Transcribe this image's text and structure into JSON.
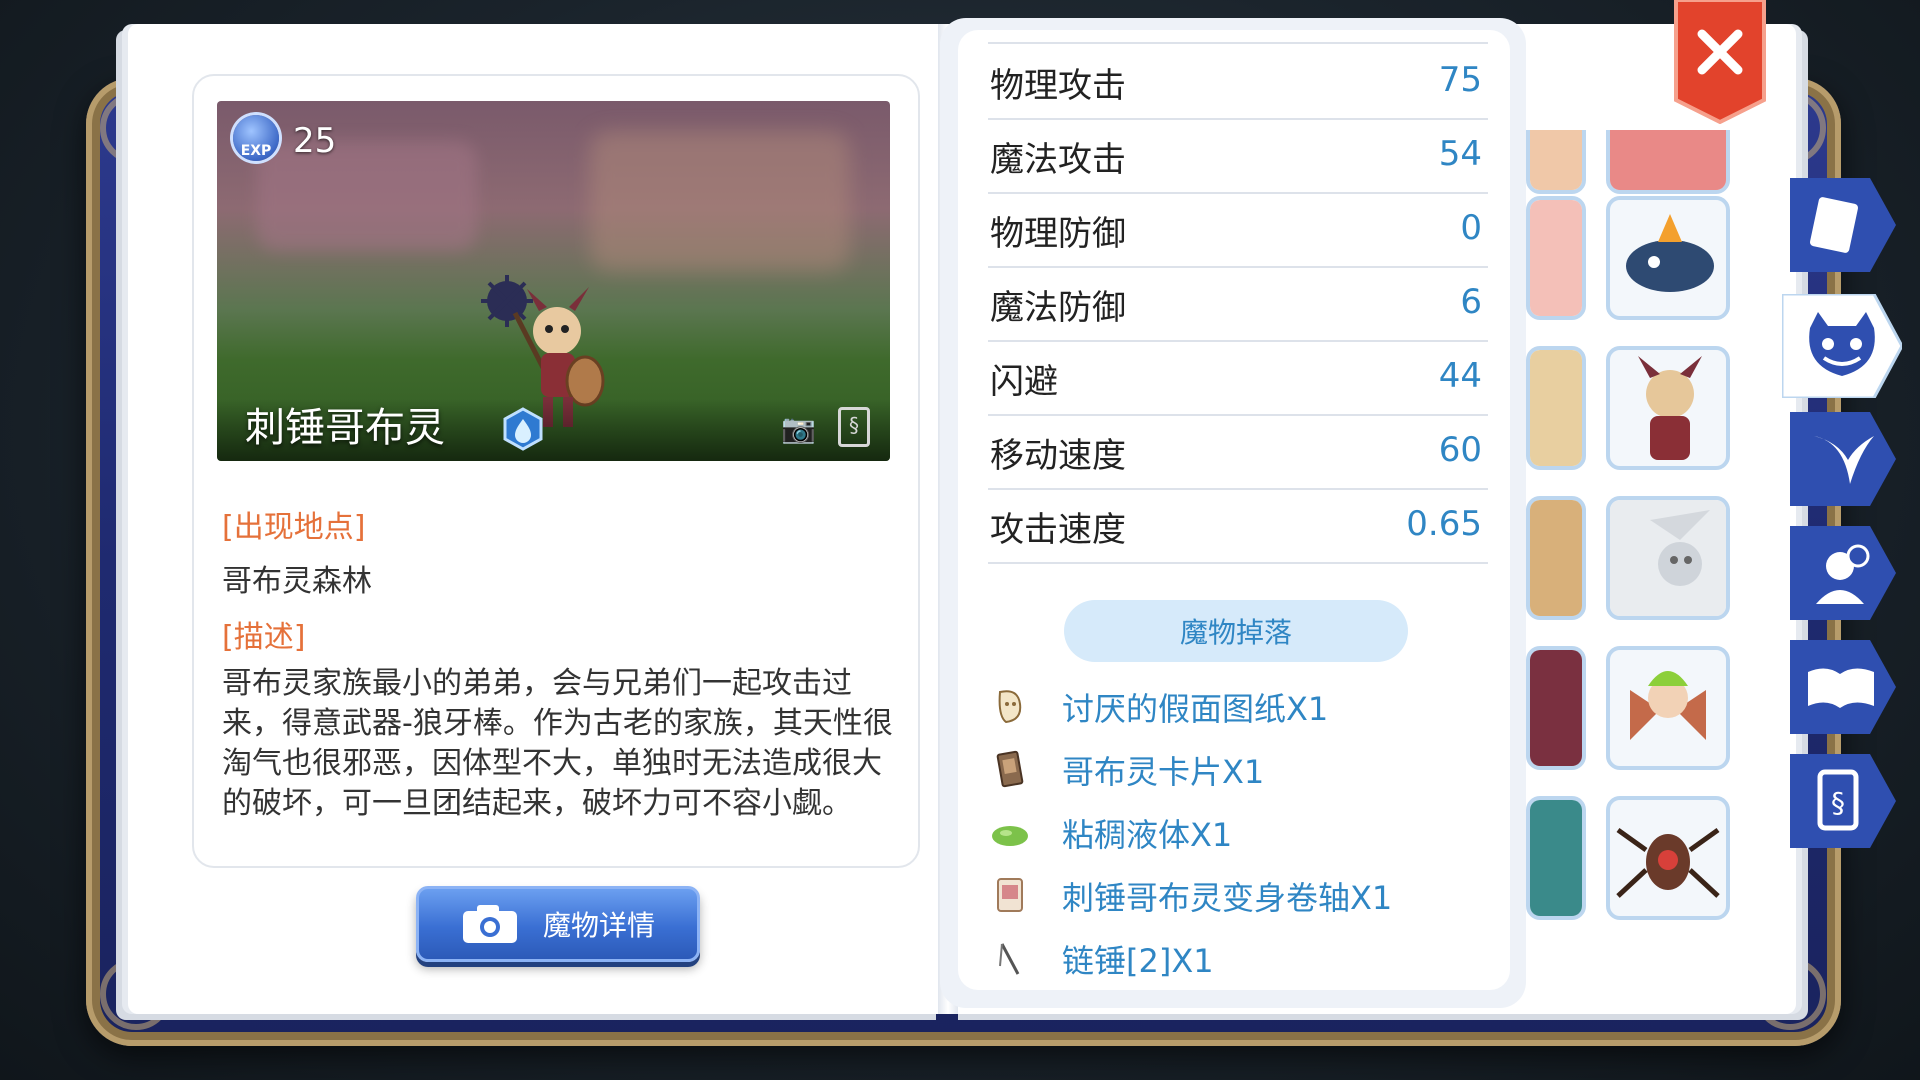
{
  "monster": {
    "exp_badge_label": "EXP",
    "exp_value": "25",
    "name": "刺锤哥布灵"
  },
  "location": {
    "title": "[出现地点]",
    "value": "哥布灵森林"
  },
  "description": {
    "title": "[描述]",
    "text": "哥布灵家族最小的弟弟，会与兄弟们一起攻击过来，得意武器-狼牙棒。作为古老的家族，其天性很淘气也很邪恶，因体型不大，单独时无法造成很大的破坏，可一旦团结起来，破坏力可不容小觑。"
  },
  "detail_button": {
    "label": "魔物详情"
  },
  "stats": [
    {
      "label": "物理攻击",
      "value": "75"
    },
    {
      "label": "魔法攻击",
      "value": "54"
    },
    {
      "label": "物理防御",
      "value": "0"
    },
    {
      "label": "魔法防御",
      "value": "6"
    },
    {
      "label": "闪避",
      "value": "44"
    },
    {
      "label": "移动速度",
      "value": "60"
    },
    {
      "label": "攻击速度",
      "value": "0.65"
    }
  ],
  "drops": {
    "header": "魔物掉落",
    "items": [
      {
        "label": "讨厌的假面图纸X1",
        "icon": "blueprint-icon"
      },
      {
        "label": "哥布灵卡片X1",
        "icon": "card-icon"
      },
      {
        "label": "粘稠液体X1",
        "icon": "slime-icon"
      },
      {
        "label": "刺锤哥布灵变身卷轴X1",
        "icon": "scroll-icon"
      },
      {
        "label": "链锤[2]X1",
        "icon": "flail-icon"
      }
    ]
  },
  "colors": {
    "accent_blue": "#2f86c4",
    "section_orange": "#e5713a",
    "close_red": "#e2432c",
    "tab_blue": "#2f4fb0"
  }
}
